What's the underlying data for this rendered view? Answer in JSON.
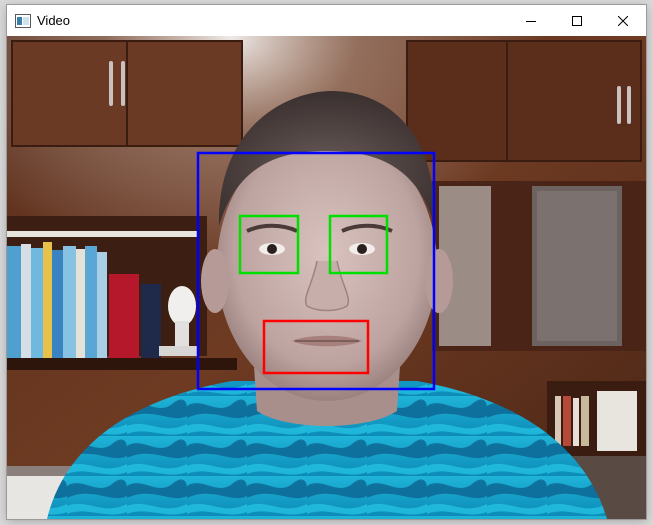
{
  "window": {
    "title": "Video",
    "icon": "app-window-icon",
    "controls": {
      "minimize_icon": "minimize-icon",
      "maximize_icon": "maximize-icon",
      "close_icon": "close-icon"
    }
  },
  "detections": {
    "face": {
      "color": "#0000ff"
    },
    "eyes": {
      "color": "#00e000",
      "count": 2
    },
    "mouth": {
      "color": "#ff0000"
    }
  }
}
